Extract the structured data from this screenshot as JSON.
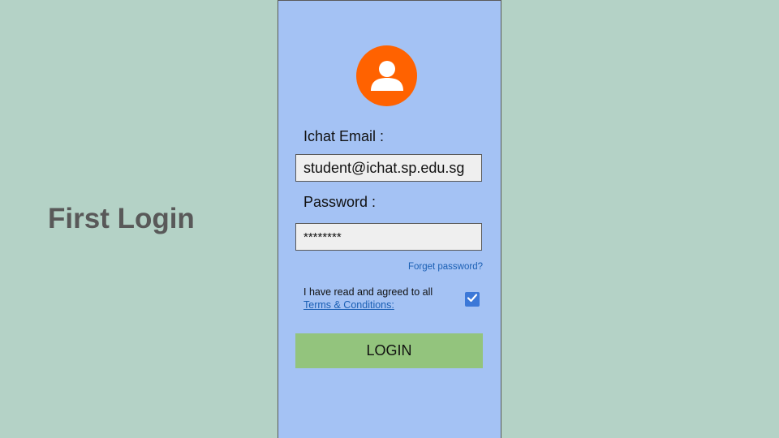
{
  "slide": {
    "title": "First Login"
  },
  "login_form": {
    "avatar_icon": "user-icon",
    "email_label": "Ichat Email :",
    "email_value": "student@ichat.sp.edu.sg",
    "password_label": "Password :",
    "password_value": "********",
    "forgot_password_link": "Forget password?",
    "terms_text": "I have read and agreed to all",
    "terms_link": "Terms & Conditions:",
    "terms_checked": true,
    "login_button": "LOGIN"
  },
  "colors": {
    "background": "#b4d2c6",
    "phone_background": "#a4c2f4",
    "avatar": "#ff6200",
    "checkbox": "#3c78d8",
    "login_button": "#93c47d",
    "link": "#1a5fb4"
  }
}
